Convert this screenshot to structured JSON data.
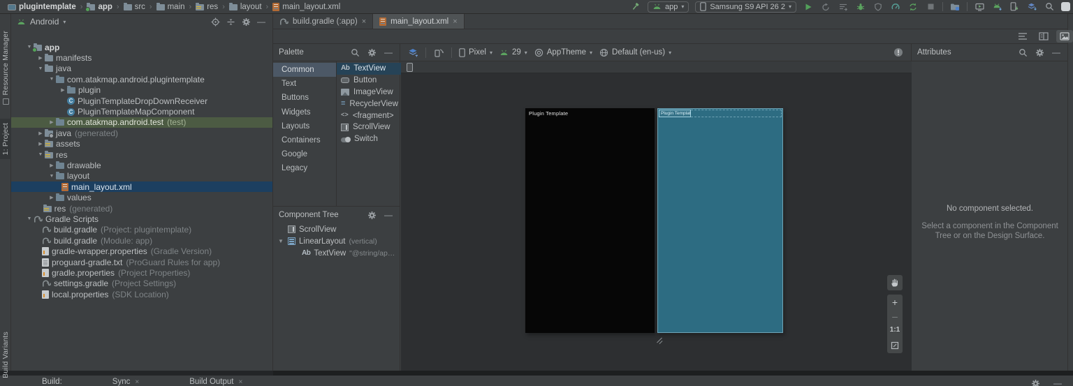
{
  "colors": {
    "bg": "#3c3f41",
    "bg_canvas": "#2d2f31",
    "panel_line": "#323232",
    "selection_blue": "#1c3f60",
    "selection_green": "#4c5b43",
    "palette_selection": "#264357",
    "accent_green": "#52a05a",
    "blueprint_teal": "#2d6c82",
    "blueprint_line": "#9fcfdf",
    "tab_active": "#4f5355"
  },
  "breadcrumbs": {
    "items": [
      {
        "label": "plugintemplate",
        "icon": "project-icon",
        "bold": true
      },
      {
        "label": "app",
        "icon": "app-folder-icon",
        "bold": true
      },
      {
        "label": "src",
        "icon": "folder-icon",
        "bold": false
      },
      {
        "label": "main",
        "icon": "folder-icon",
        "bold": false
      },
      {
        "label": "res",
        "icon": "res-folder-icon",
        "bold": false
      },
      {
        "label": "layout",
        "icon": "folder-icon",
        "bold": false
      },
      {
        "label": "main_layout.xml",
        "icon": "xml-file-icon",
        "bold": false
      }
    ]
  },
  "toolbar": {
    "run_config": "app",
    "device": "Samsung S9 API 26 2",
    "actions_run": [
      "run-button",
      "rerun-button",
      "apply-code-changes-button",
      "debug-button",
      "run-with-coverage-button",
      "profiler-button",
      "sync-project-button",
      "stop-button"
    ],
    "actions_right": [
      "project-structure-button",
      "device-manager-button",
      "sdk-manager-button",
      "device-file-explorer-button",
      "vcs-update-button",
      "search-everywhere-button",
      "user-avatar"
    ]
  },
  "left_stripe": {
    "top": [
      {
        "label": "Resource Manager",
        "active": false
      },
      {
        "label": "1: Project",
        "active": true
      }
    ],
    "bottom": [
      {
        "label": "Build Variants",
        "active": false
      }
    ]
  },
  "project": {
    "view": "Android",
    "tree": [
      {
        "d": 1,
        "a": "v",
        "i": "folder-app",
        "label": "app",
        "bold": true
      },
      {
        "d": 2,
        "a": "r",
        "i": "folder",
        "label": "manifests"
      },
      {
        "d": 2,
        "a": "v",
        "i": "folder",
        "label": "java"
      },
      {
        "d": 3,
        "a": "v",
        "i": "pkg",
        "label": "com.atakmap.android.plugintemplate"
      },
      {
        "d": 4,
        "a": "r",
        "i": "pkg",
        "label": "plugin"
      },
      {
        "d": 4,
        "a": null,
        "i": "class",
        "label": "PluginTemplateDropDownReceiver"
      },
      {
        "d": 4,
        "a": null,
        "i": "class",
        "label": "PluginTemplateMapComponent"
      },
      {
        "d": 3,
        "a": "r",
        "i": "pkg",
        "label": "com.atakmap.android.test",
        "meta": "(test)",
        "sel": "green"
      },
      {
        "d": 2,
        "a": "r",
        "i": "folder-gen",
        "label": "java",
        "meta": "(generated)"
      },
      {
        "d": 2,
        "a": "r",
        "i": "folder-res",
        "label": "assets"
      },
      {
        "d": 2,
        "a": "v",
        "i": "folder-res",
        "label": "res"
      },
      {
        "d": 3,
        "a": "r",
        "i": "pkg",
        "label": "drawable"
      },
      {
        "d": 3,
        "a": "v",
        "i": "pkg",
        "label": "layout"
      },
      {
        "d": 3.5,
        "a": null,
        "i": "xml",
        "label": "main_layout.xml",
        "sel": "blue"
      },
      {
        "d": 3,
        "a": "r",
        "i": "pkg",
        "label": "values"
      },
      {
        "d": 2.6,
        "a": null,
        "ns": true,
        "i": "folder-res",
        "label": "res",
        "meta": "(generated)"
      },
      {
        "d": 1,
        "a": "v",
        "i": "gradle",
        "label": "Gradle Scripts"
      },
      {
        "d": 2.5,
        "a": null,
        "ns": true,
        "i": "gradle",
        "label": "build.gradle",
        "meta": "(Project: plugintemplate)"
      },
      {
        "d": 2.5,
        "a": null,
        "ns": true,
        "i": "gradle",
        "label": "build.gradle",
        "meta": "(Module: app)"
      },
      {
        "d": 2.5,
        "a": null,
        "ns": true,
        "i": "props",
        "label": "gradle-wrapper.properties",
        "meta": "(Gradle Version)"
      },
      {
        "d": 2.5,
        "a": null,
        "ns": true,
        "i": "txt",
        "label": "proguard-gradle.txt",
        "meta": "(ProGuard Rules for app)"
      },
      {
        "d": 2.5,
        "a": null,
        "ns": true,
        "i": "props",
        "label": "gradle.properties",
        "meta": "(Project Properties)"
      },
      {
        "d": 2.5,
        "a": null,
        "ns": true,
        "i": "gradle",
        "label": "settings.gradle",
        "meta": "(Project Settings)"
      },
      {
        "d": 2.5,
        "a": null,
        "ns": true,
        "i": "props",
        "label": "local.properties",
        "meta": "(SDK Location)"
      }
    ]
  },
  "editor": {
    "tabs": [
      {
        "label": "build.gradle (:app)",
        "icon": "gradle",
        "active": false
      },
      {
        "label": "main_layout.xml",
        "icon": "xml",
        "active": true
      }
    ]
  },
  "palette": {
    "title": "Palette",
    "categories": [
      {
        "label": "Common",
        "selected": true
      },
      {
        "label": "Text",
        "selected": false
      },
      {
        "label": "Buttons",
        "selected": false
      },
      {
        "label": "Widgets",
        "selected": false
      },
      {
        "label": "Layouts",
        "selected": false
      },
      {
        "label": "Containers",
        "selected": false
      },
      {
        "label": "Google",
        "selected": false
      },
      {
        "label": "Legacy",
        "selected": false
      }
    ],
    "items": [
      {
        "label": "TextView",
        "icon": "textview",
        "selected": true,
        "download": false
      },
      {
        "label": "Button",
        "icon": "button",
        "selected": false,
        "download": false
      },
      {
        "label": "ImageView",
        "icon": "imageview",
        "selected": false,
        "download": false
      },
      {
        "label": "RecyclerView",
        "icon": "recycler",
        "selected": false,
        "download": true
      },
      {
        "label": "<fragment>",
        "icon": "fragment",
        "selected": false,
        "download": false
      },
      {
        "label": "ScrollView",
        "icon": "scrollview",
        "selected": false,
        "download": false
      },
      {
        "label": "Switch",
        "icon": "switch",
        "selected": false,
        "download": false
      }
    ]
  },
  "design_toolbar": {
    "device": "Pixel",
    "api": "29",
    "theme": "AppTheme",
    "locale": "Default (en-us)"
  },
  "component_tree": {
    "title": "Component Tree",
    "items": [
      {
        "label": "ScrollView",
        "icon": "scrollview",
        "meta": "",
        "arrow": false,
        "indent": 0
      },
      {
        "label": "LinearLayout",
        "icon": "linearlayout",
        "meta": "(vertical)",
        "arrow": true,
        "indent": 0
      },
      {
        "label": "TextView",
        "icon": "textview",
        "meta": "\"@string/app_na...",
        "arrow": false,
        "indent": 1
      }
    ]
  },
  "design": {
    "phone_label": "Plugin Template",
    "blueprint_label": "Plugin Template",
    "zoom_in": "+",
    "zoom_out": "–",
    "zoom_ratio": "1:1"
  },
  "attributes": {
    "title": "Attributes",
    "empty_title": "No component selected.",
    "empty_hint": "Select a component in the Component Tree or on the Design Surface."
  },
  "bottom": {
    "label": "Build:",
    "tabs": [
      {
        "label": "Sync"
      },
      {
        "label": "Build Output"
      }
    ]
  }
}
